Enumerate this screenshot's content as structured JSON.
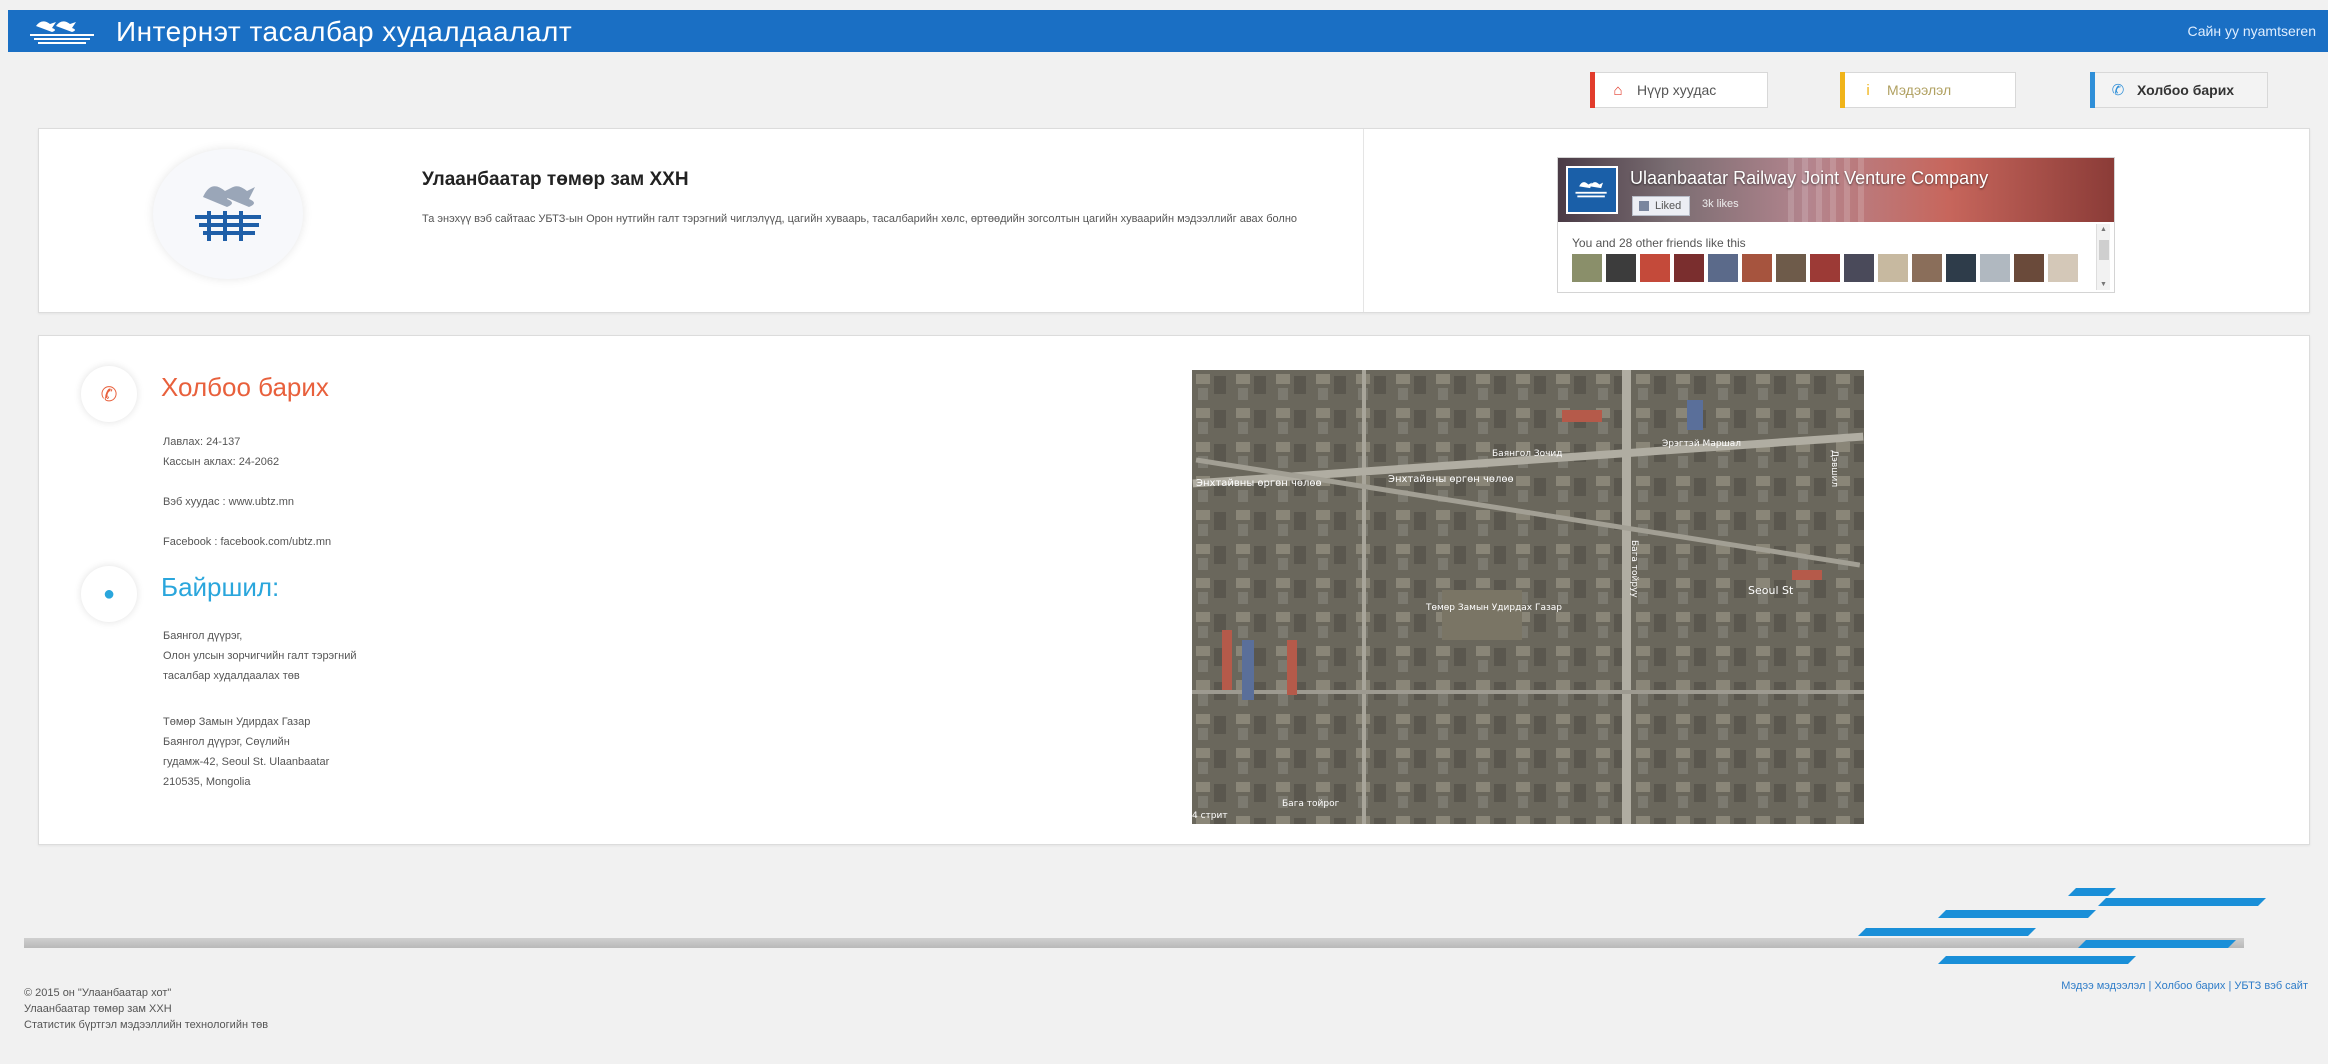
{
  "header": {
    "title": "Интернэт тасалбар худалдаалалт",
    "greeting": "Сайн уу nyamtseren"
  },
  "nav": {
    "home": "Нүүр хуудас",
    "info": "Мэдээлэл",
    "contact": "Холбоо барих"
  },
  "about": {
    "title": "Улаанбаатар төмөр зам ХХН",
    "description": "Та энэхүү вэб сайтаас УБТЗ-ын Орон нутгийн галт тэрэгний чиглэлүүд, цагийн хуваарь, тасалбарийн хөлс, өртөөдийн зогсолтын цагийн хуваарийн мэдээллийг авах болно"
  },
  "facebook": {
    "page_name": "Ulaanbaatar Railway Joint Venture Company",
    "liked_label": "Liked",
    "likes_count": "3k likes",
    "friends_text": "You and 28 other friends like this",
    "avatar_colors": [
      "#8a8f6a",
      "#3c3c3c",
      "#c44a3a",
      "#7a2e2e",
      "#5b6a8a",
      "#a6543e",
      "#6e5b4a",
      "#9c3a36",
      "#4a4a5a",
      "#c7b9a0",
      "#8a6e5a",
      "#2e3c4a",
      "#b0b8c0",
      "#6a4a3a",
      "#d4c8b8"
    ]
  },
  "contact": {
    "title": "Холбоо барих",
    "phone": "Лавлах: 24-137",
    "cashier": "Кассын аклах: 24-2062",
    "website": "Вэб хуудас : www.ubtz.mn",
    "facebook": "Facebook : facebook.com/ubtz.mn"
  },
  "location": {
    "title": "Байршил:",
    "lines1": [
      "Баянгол дүүрэг,",
      "Олон улсын зорчигчийн галт тэрэгний",
      "тасалбар худалдаалах төв"
    ],
    "lines2": [
      "Төмөр Замын Удирдах Газар",
      "Баянгол дүүрэг, Сөүлийн",
      "гудамж-42, Seoul St. Ulaanbaatar",
      "210535, Mongolia"
    ]
  },
  "map": {
    "labels": [
      "Энхтайвны өргөн чөлөө",
      "Энхтайвны өргөн чөлөө",
      "Seoul St",
      "Төмөр Замын Удирдах Газар",
      "Баянгол Зочид",
      "Эрэгтэй Маршал",
      "Бага тойруу",
      "Дэвшил",
      "4 стрит",
      "Бага тойрог"
    ]
  },
  "footer": {
    "lines": [
      "© 2015 он \"Улаанбаатар хот\"",
      "Улаанбаатар төмөр зам ХХН",
      "Статистик бүртгэл мэдээллийн технологийн төв"
    ],
    "links": "Мэдээ мэдээлэл | Холбоо барих | УБТЗ вэб сайт"
  }
}
